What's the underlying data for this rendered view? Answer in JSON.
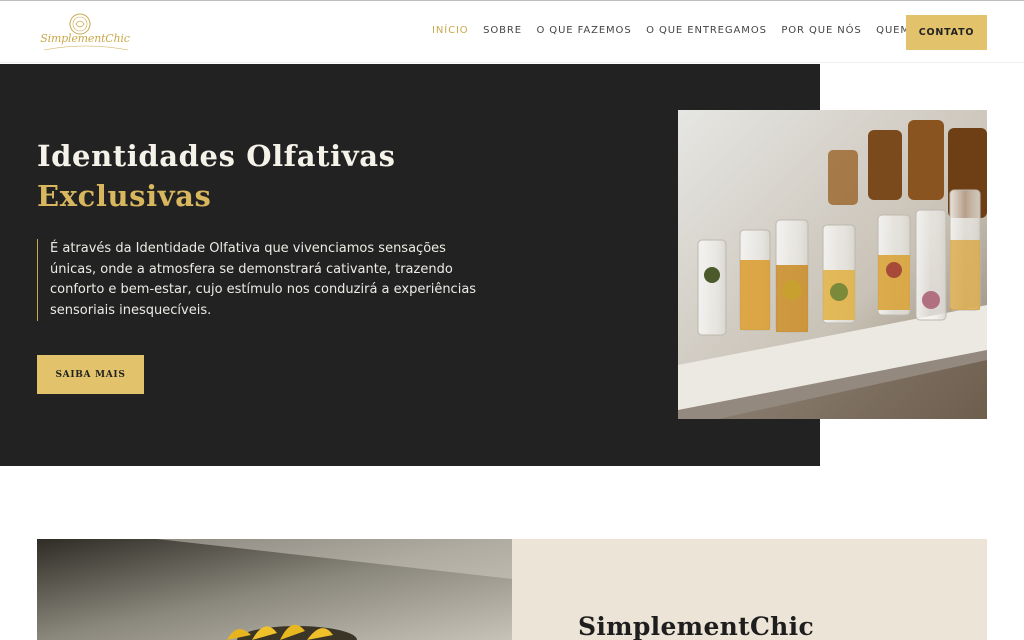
{
  "header": {
    "logo_text": "SimplementChic",
    "nav": [
      {
        "label": "INÍCIO",
        "active": true
      },
      {
        "label": "SOBRE",
        "active": false
      },
      {
        "label": "O QUE FAZEMOS",
        "active": false
      },
      {
        "label": "O QUE ENTREGAMOS",
        "active": false
      },
      {
        "label": "POR QUE NÓS",
        "active": false
      },
      {
        "label": "QUEM SOMOS",
        "active": false
      }
    ],
    "contact_label": "CONTATO"
  },
  "hero": {
    "title_line1": "Identidades Olfativas",
    "title_line2": "Exclusivas",
    "text": "É através da Identidade Olfativa que vivenciamos sensações únicas, onde a atmosfera se demonstrará cativante, trazendo conforto e bem-estar, cujo estímulo nos conduzirá a experiências sensoriais inesquecíveis.",
    "button_label": "SAIBA MAIS",
    "image": "perfume-vials-photo"
  },
  "section2": {
    "title": "SimplementChic",
    "image": "sunflower-photo"
  },
  "colors": {
    "accent": "#e2c36b",
    "gold_text": "#d9b75e",
    "hero_bg": "#232222",
    "panel_bg": "#ece4d6"
  }
}
